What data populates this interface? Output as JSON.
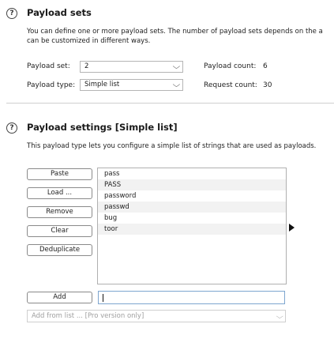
{
  "payload_sets": {
    "heading": "Payload sets",
    "help_icon": "?",
    "description_line1": "You can define one or more payload sets. The number of payload sets depends on the a",
    "description_line2": "can be customized in different ways.",
    "payload_set_label": "Payload set:",
    "payload_set_value": "2",
    "payload_type_label": "Payload type:",
    "payload_type_value": "Simple list",
    "payload_count_label": "Payload count:",
    "payload_count_value": "6",
    "request_count_label": "Request count:",
    "request_count_value": "30"
  },
  "payload_settings": {
    "heading": "Payload settings [Simple list]",
    "help_icon": "?",
    "description": "This payload type lets you configure a simple list of strings that are used as payloads.",
    "buttons": {
      "paste": "Paste",
      "load": "Load ...",
      "remove": "Remove",
      "clear": "Clear",
      "deduplicate": "Deduplicate",
      "add": "Add"
    },
    "items": [
      "pass",
      "PASS",
      "password",
      "passwd",
      "bug",
      "toor"
    ],
    "add_input_value": "",
    "add_from_list_placeholder": "Add from list ... [Pro version only]"
  },
  "icons": {
    "chevron": "⌵",
    "help": "question-circle"
  }
}
